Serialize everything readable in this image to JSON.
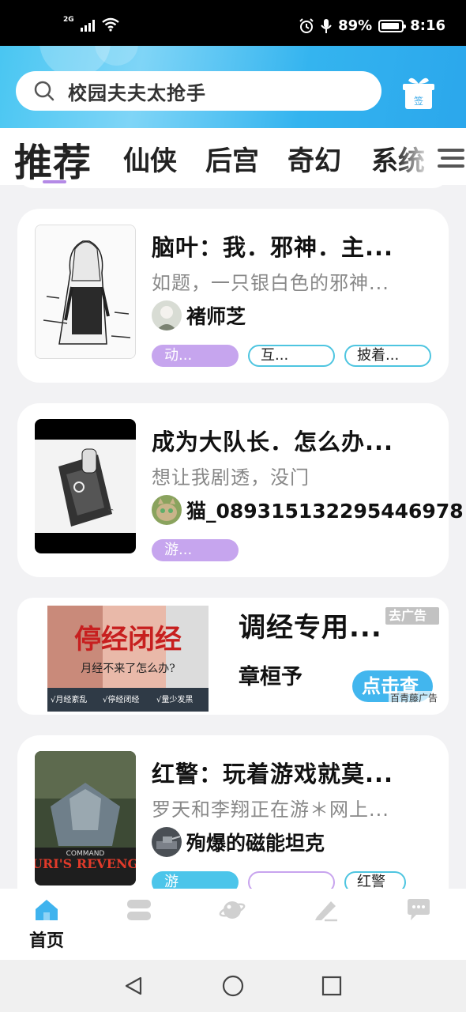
{
  "status_bar": {
    "network": "2G",
    "battery_percent": "89%",
    "battery_level": 0.89,
    "time": "8:16"
  },
  "search": {
    "placeholder": "校园夫夫太抢手",
    "sign_icon_label": "签"
  },
  "tabs": [
    {
      "label": "推荐",
      "active": true
    },
    {
      "label": "仙侠",
      "active": false
    },
    {
      "label": "后宫",
      "active": false
    },
    {
      "label": "奇幻",
      "active": false
    },
    {
      "label": "系统",
      "active": false
    }
  ],
  "books": [
    {
      "title": "脑叶：我．邪神．主...",
      "desc": "如题，一只银白色的邪神...",
      "author": "褚师芝",
      "tags": [
        "动...",
        "互...",
        "披着..."
      ]
    },
    {
      "title": "成为大队长．怎么办...",
      "desc": "想让我剧透，没门",
      "author": "猫_089315132295446978",
      "tags": [
        "游..."
      ]
    },
    {
      "title": "红警：玩着游戏就莫...",
      "desc": "罗天和李翔正在游＊网上...",
      "author": "殉爆的磁能坦克",
      "tags": [
        "游",
        "",
        "红警"
      ]
    }
  ],
  "ad": {
    "image_headline": "停经闭经",
    "image_subline": "月经不来了怎么办?",
    "image_points": [
      "√月经紊乱",
      "√停经闭经",
      "√量少发黑"
    ],
    "title": "调经专用...",
    "author": "章桓予",
    "close_label": "去广告",
    "cta_label": "点击查",
    "source": "百青藤广告"
  },
  "bottom_nav": [
    {
      "label": "首页",
      "icon": "home-icon",
      "active": true
    },
    {
      "label": "",
      "icon": "category-icon",
      "active": false
    },
    {
      "label": "",
      "icon": "discover-planet-icon",
      "active": false
    },
    {
      "label": "",
      "icon": "write-pencil-icon",
      "active": false
    },
    {
      "label": "",
      "icon": "message-icon",
      "active": false
    }
  ],
  "colors": {
    "header_blue": "#34b4ef",
    "accent_purple": "#c6a5ee",
    "accent_teal": "#4cc5ea",
    "nav_active": "#3fb3ee",
    "nav_inactive": "#d0d0d0"
  }
}
